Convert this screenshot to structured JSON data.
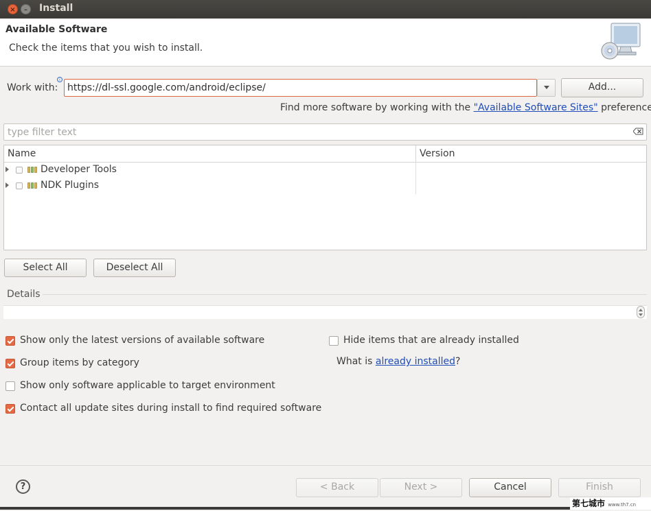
{
  "window": {
    "title": "Install"
  },
  "banner": {
    "title": "Available Software",
    "description": "Check the items that you wish to install.",
    "graphic_icon": "monitor-cd-icon"
  },
  "work_with": {
    "label": "Work with:",
    "value": "https://dl-ssl.google.com/android/eclipse/",
    "add_label": "Add...",
    "find_more_prefix": "Find more software by working with the ",
    "find_more_link": "\"Available Software Sites\"",
    "find_more_suffix": " preferences."
  },
  "filter": {
    "placeholder": "type filter text"
  },
  "tree": {
    "columns": [
      "Name",
      "Version"
    ],
    "rows": [
      {
        "label": "Developer Tools",
        "version": ""
      },
      {
        "label": "NDK Plugins",
        "version": ""
      }
    ]
  },
  "selection": {
    "select_all": "Select All",
    "deselect_all": "Deselect All"
  },
  "details": {
    "label": "Details"
  },
  "options": {
    "latest_versions": {
      "label": "Show only the latest versions of available software",
      "checked": true
    },
    "group_by_category": {
      "label": "Group items by category",
      "checked": true
    },
    "target_env": {
      "label": "Show only software applicable to target environment",
      "checked": false
    },
    "contact_sites": {
      "label": "Contact all update sites during install to find required software",
      "checked": true
    },
    "hide_installed": {
      "label": "Hide items that are already installed",
      "checked": false
    }
  },
  "already_installed": {
    "prefix": "What is ",
    "link": "already installed",
    "suffix": "?"
  },
  "footer": {
    "help": "?",
    "back": "< Back",
    "next": "Next >",
    "cancel": "Cancel",
    "finish": "Finish"
  },
  "watermark": {
    "main": "第七城市",
    "sub": "www.th7.cn"
  },
  "colors": {
    "accent": "#e36a44",
    "link": "#1f4db8",
    "titlebar": "#3b3a36"
  }
}
